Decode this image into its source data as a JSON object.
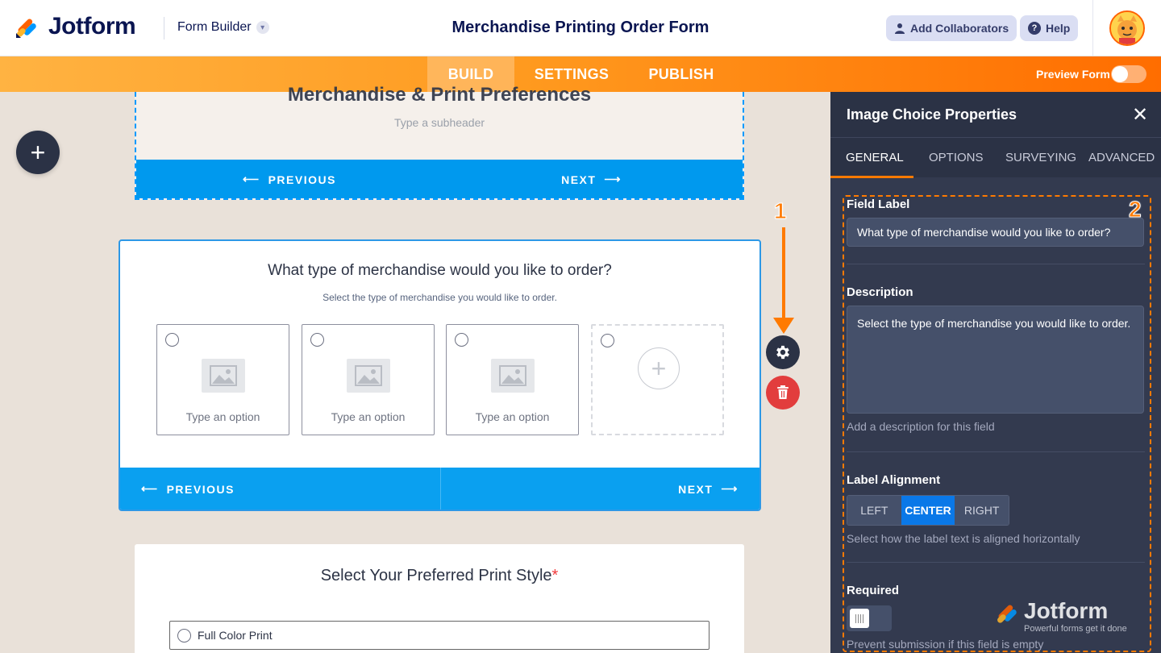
{
  "topbar": {
    "logo_text": "Jotform",
    "form_builder_label": "Form Builder",
    "form_title": "Merchandise Printing Order Form",
    "add_collaborators": "Add Collaborators",
    "help": "Help"
  },
  "nav": {
    "tabs": [
      "BUILD",
      "SETTINGS",
      "PUBLISH"
    ],
    "active_tab": "BUILD",
    "preview_label": "Preview Form"
  },
  "canvas": {
    "top_card": {
      "heading": "Merchandise & Print Preferences",
      "subheader": "Type a subheader",
      "previous": "PREVIOUS",
      "next": "NEXT"
    },
    "main_card": {
      "question": "What type of merchandise would you like to order?",
      "description": "Select the type of merchandise you would like to order.",
      "options": [
        "Type an option",
        "Type an option",
        "Type an option"
      ],
      "previous": "PREVIOUS",
      "next": "NEXT"
    },
    "bottom_card": {
      "title": "Select Your Preferred Print Style",
      "required_mark": "*",
      "first_choice": "Full Color Print"
    }
  },
  "annotations": {
    "one": "1",
    "two": "2"
  },
  "panel": {
    "title": "Image Choice Properties",
    "tabs": [
      "GENERAL",
      "OPTIONS",
      "SURVEYING",
      "ADVANCED"
    ],
    "active_tab": "GENERAL",
    "field_label": {
      "label": "Field Label",
      "value": "What type of merchandise would you like to order?"
    },
    "description": {
      "label": "Description",
      "value": "Select the type of merchandise you would like to order.",
      "hint": "Add a description for this field"
    },
    "label_alignment": {
      "label": "Label Alignment",
      "options": [
        "LEFT",
        "CENTER",
        "RIGHT"
      ],
      "selected": "CENTER",
      "hint": "Select how the label text is aligned horizontally"
    },
    "required": {
      "label": "Required",
      "on": false,
      "hint": "Prevent submission if this field is empty"
    },
    "watermark": {
      "text": "Jotform",
      "tagline": "Powerful forms get it done"
    }
  },
  "colors": {
    "accent_orange": "#ff7a00",
    "brand_blue": "#0099ee",
    "panel_bg": "#333a4f",
    "danger": "#e23d3d"
  }
}
